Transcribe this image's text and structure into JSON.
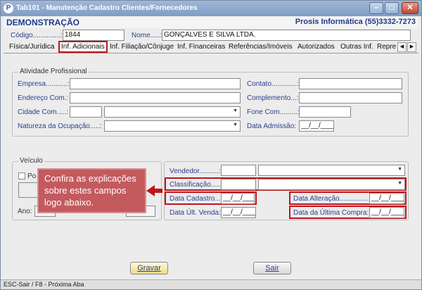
{
  "window": {
    "title": "Tab101 - Manutenção Cadastro Clientes/Fornecedores",
    "app_icon": "P"
  },
  "header": {
    "company": "DEMONSTRAÇÃO",
    "vendor": "Prosis Informática (55)3332-7273"
  },
  "record": {
    "codigo_label": "Código..............:",
    "codigo_value": "1844",
    "nome_label": "Nome.....:",
    "nome_value": "GONÇALVES E SILVA LTDA."
  },
  "tabs": [
    "Física/Jurídica",
    "Inf. Adicionais",
    "Inf. Filiação/Cônjuge",
    "Inf. Financeiras",
    "Referências/Imóveis",
    "Autorizados",
    "Outras Inf.",
    "Repre"
  ],
  "atividade": {
    "title": "Atividade Profissional",
    "empresa": "Empresa...........:",
    "endereco": "Endereço Com.:",
    "cidade": "Cidade Com.....:",
    "natureza": "Natureza da  Ocupação.....:",
    "contato": "Contato.............:",
    "complemento": "Complemento...:",
    "fone": "Fone Com.........:",
    "data_admissao": "Data Admissão:",
    "date_placeholder": "__/__/____"
  },
  "veiculo": {
    "title": "Veículo",
    "pos_label": "Po",
    "ano_label": "Ano:"
  },
  "extra": {
    "vendedor": "Vendedor..........:",
    "classificacao": "Classificação......:",
    "data_cadastro": "Data Cadastro.....:",
    "data_ult_venda": "Data Últ. Venda:",
    "data_alteracao": "Data Alteração...............:",
    "data_ultima_compra": "Data da Última Compra:",
    "date_placeholder": "__/__/____"
  },
  "callout": "Confira as explicações sobre estes campos logo abaixo.",
  "buttons": {
    "gravar": "Gravar",
    "sair": "Sair"
  },
  "status": "ESC-Sair / F8 - Próxima Aba",
  "colors": {
    "accent": "#c0141a",
    "label": "#2b3f8c",
    "callout": "#c35a5e"
  }
}
